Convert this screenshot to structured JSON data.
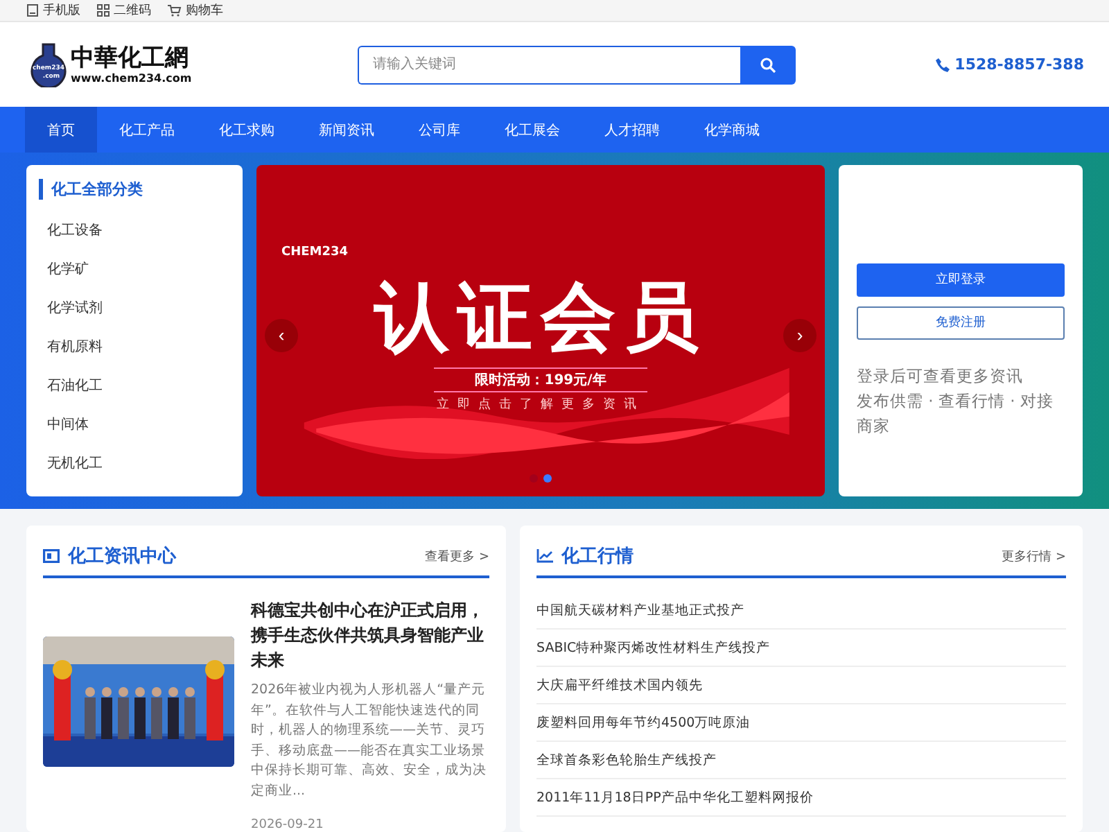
{
  "top_bar": [
    {
      "kind": "mobile",
      "label": "手机版"
    },
    {
      "kind": "qr",
      "label": "二维码"
    },
    {
      "kind": "cart",
      "label": "购物车"
    }
  ],
  "logo": {
    "name": "中華化工網",
    "url": "www.chem234.com",
    "badge_top": "chem234",
    "badge_bottom": ".com"
  },
  "search": {
    "placeholder": "请输入关键词"
  },
  "phone": "1528-8857-388",
  "nav": [
    {
      "label": "首页",
      "selected": true
    },
    {
      "label": "化工产品",
      "selected": false
    },
    {
      "label": "化工求购",
      "selected": false
    },
    {
      "label": "新闻资讯",
      "selected": false
    },
    {
      "label": "公司库",
      "selected": false
    },
    {
      "label": "化工展会",
      "selected": false
    },
    {
      "label": "人才招聘",
      "selected": false
    },
    {
      "label": "化学商城",
      "selected": false
    }
  ],
  "categories": {
    "title": "化工全部分类",
    "items": [
      "化工设备",
      "化学矿",
      "化学试剂",
      "有机原料",
      "石油化工",
      "中间体",
      "无机化工"
    ]
  },
  "banner": {
    "brand": "CHEM234",
    "headline": "认证会员",
    "offer": "限时活动：199元/年",
    "cta": "立即点击了解更多资讯",
    "prev": "‹",
    "next": "›",
    "dots": [
      {
        "selected": false
      },
      {
        "selected": true
      }
    ]
  },
  "login": {
    "buttons": [
      {
        "kind": "primary",
        "label": "立即登录"
      },
      {
        "kind": "outline",
        "label": "免费注册"
      }
    ],
    "note": [
      "登录后可查看更多资讯",
      "发布供需 · 查看行情 · 对接商家"
    ]
  },
  "news": {
    "title": "化工资讯中心",
    "more": "查看更多 >",
    "article": {
      "title": "科德宝共创中心在沪正式启用，携手生态伙伴共筑具身智能产业未来",
      "summary": "2026年被业内视为人形机器人“量产元年”。在软件与人工智能快速迭代的同时，机器人的物理系统——关节、灵巧手、移动底盘——能否在真实工业场景中保持长期可靠、高效、安全，成为决定商业...",
      "date": "2026-09-21"
    }
  },
  "market": {
    "title": "化工行情",
    "more": "更多行情 >",
    "items": [
      "中国航天碳材料产业基地正式投产",
      "SABIC特种聚丙烯改性材料生产线投产",
      "大庆扁平纤维技术国内领先",
      "废塑料回用每年节约4500万吨原油",
      "全球首条彩色轮胎生产线投产",
      "2011年11月18日PP产品中华化工塑料网报价"
    ]
  }
}
